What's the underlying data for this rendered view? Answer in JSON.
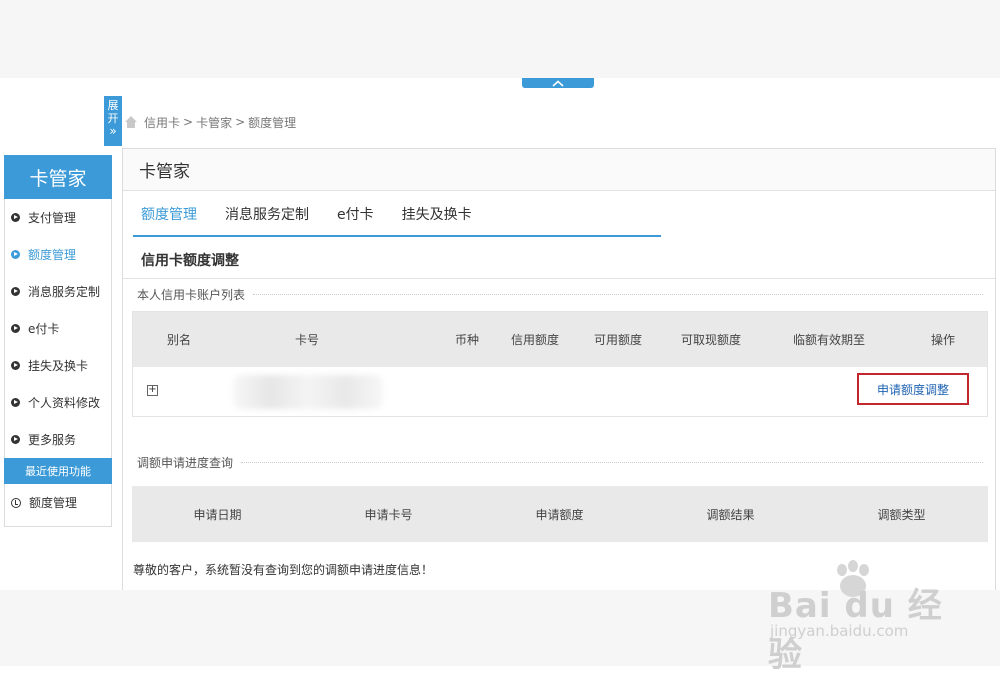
{
  "colors": {
    "accent": "#3b9ad7",
    "highlight_border": "#c1272d",
    "link": "#1f63b3"
  },
  "expand_tab": {
    "label_1": "展",
    "label_2": "开",
    "chevron": "»"
  },
  "breadcrumb": {
    "items": [
      "信用卡",
      "卡管家",
      "额度管理"
    ],
    "separator": ">"
  },
  "sidebar": {
    "title": "卡管家",
    "items": [
      {
        "label": "支付管理",
        "active": false
      },
      {
        "label": "额度管理",
        "active": true
      },
      {
        "label": "消息服务定制",
        "active": false
      },
      {
        "label": "e付卡",
        "active": false
      },
      {
        "label": "挂失及换卡",
        "active": false
      },
      {
        "label": "个人资料修改",
        "active": false
      },
      {
        "label": "更多服务",
        "active": false
      }
    ],
    "recent_header": "最近使用功能",
    "recent_items": [
      {
        "label": "额度管理"
      }
    ]
  },
  "main": {
    "title": "卡管家",
    "tabs": [
      {
        "label": "额度管理",
        "active": true
      },
      {
        "label": "消息服务定制",
        "active": false
      },
      {
        "label": "e付卡",
        "active": false
      },
      {
        "label": "挂失及换卡",
        "active": false
      }
    ],
    "section_title": "信用卡额度调整",
    "accounts": {
      "subtitle": "本人信用卡账户列表",
      "columns": [
        "别名",
        "卡号",
        "币种",
        "信用额度",
        "可用额度",
        "可取现额度",
        "临额有效期至",
        "操作"
      ],
      "row": {
        "expand_symbol": "+",
        "action": "申请额度调整"
      }
    },
    "progress": {
      "subtitle": "调额申请进度查询",
      "columns": [
        "申请日期",
        "申请卡号",
        "申请额度",
        "调额结果",
        "调额类型"
      ],
      "empty_message": "尊敬的客户，系统暂没有查询到您的调额申请进度信息！"
    }
  },
  "watermark": {
    "main": "Bai du 经验",
    "sub": "jingyan.baidu.com"
  }
}
